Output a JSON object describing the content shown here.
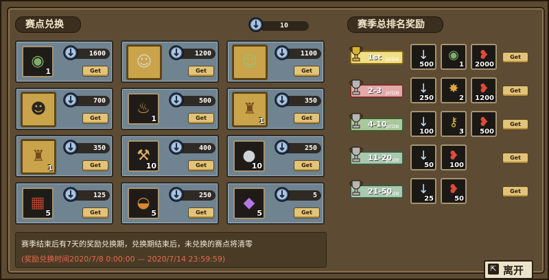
{
  "left_title": "赛点兑换",
  "right_title": "赛季总排名奖励",
  "balance": "10",
  "exchange_items": [
    {
      "icon": "jade-medallion",
      "glyph": "◉",
      "color": "#7fae6b",
      "qty": "1",
      "price": "1600",
      "get": "Get",
      "frame": "plain"
    },
    {
      "icon": "elder-portrait",
      "glyph": "☺",
      "color": "#d9d4c6",
      "qty": "",
      "price": "1200",
      "get": "Get",
      "frame": "gold"
    },
    {
      "icon": "green-warrior-portrait",
      "glyph": "☺",
      "color": "#9bc07a",
      "qty": "",
      "price": "1100",
      "get": "Get",
      "frame": "gold"
    },
    {
      "icon": "girl-portrait",
      "glyph": "☻",
      "color": "#2a2422",
      "qty": "",
      "price": "700",
      "get": "Get",
      "frame": "gold"
    },
    {
      "icon": "money-bag",
      "glyph": "♨",
      "color": "#d89a3a",
      "qty": "1",
      "price": "500",
      "get": "Get",
      "frame": "plain"
    },
    {
      "icon": "treasure-bag",
      "glyph": "♜",
      "color": "#7a4a1e",
      "qty": "1",
      "price": "350",
      "get": "Get",
      "frame": "gold"
    },
    {
      "icon": "treasure-bag",
      "glyph": "♜",
      "color": "#7a4a1e",
      "qty": "1",
      "price": "350",
      "get": "Get",
      "frame": "gold"
    },
    {
      "icon": "wrench-bag",
      "glyph": "⚒",
      "color": "#e0b06a",
      "qty": "10",
      "price": "400",
      "get": "Get",
      "frame": "plain"
    },
    {
      "icon": "bomb",
      "glyph": "●",
      "color": "#cfd3d6",
      "qty": "10",
      "price": "250",
      "get": "Get",
      "frame": "plain"
    },
    {
      "icon": "chocolate-bar",
      "glyph": "▦",
      "color": "#b4452e",
      "qty": "5",
      "price": "125",
      "get": "Get",
      "frame": "plain"
    },
    {
      "icon": "burger",
      "glyph": "◒",
      "color": "#d58a2e",
      "qty": "5",
      "price": "250",
      "get": "Get",
      "frame": "plain"
    },
    {
      "icon": "purple-gem",
      "glyph": "◆",
      "color": "#b678e8",
      "qty": "5",
      "price": "5",
      "get": "Get",
      "frame": "plain"
    }
  ],
  "notice": {
    "line1": "赛季结束后有7天的奖励兑换期，兑换期结束后，未兑换的赛点将清零",
    "line2": "(奖励兑换时间2020/7/8  0:00:00  —  2020/7/14  23:59:59)"
  },
  "ranks": [
    {
      "label": "1st",
      "prize": "prize",
      "bg": "#f0e08a",
      "border": "#8e6a12",
      "trophy": "#d7b231",
      "rewards": [
        {
          "icon": "point-coin",
          "glyph": "↓",
          "color": "#cfe0f0",
          "qty": "500"
        },
        {
          "icon": "jade-medallion",
          "glyph": "◉",
          "color": "#7fae6b",
          "qty": "1"
        },
        {
          "icon": "red-fish",
          "glyph": "❥",
          "color": "#e04a3a",
          "qty": "2000"
        }
      ]
    },
    {
      "label": "2-3",
      "prize": "prize",
      "bg": "#e3a9a9",
      "border": "#7a2f2f",
      "trophy": "#b6b6b6",
      "rewards": [
        {
          "icon": "point-coin",
          "glyph": "↓",
          "color": "#cfe0f0",
          "qty": "250"
        },
        {
          "icon": "gold-badge",
          "glyph": "✸",
          "color": "#e0a83a",
          "qty": "2"
        },
        {
          "icon": "red-fish",
          "glyph": "❥",
          "color": "#e04a3a",
          "qty": "1200"
        }
      ]
    },
    {
      "label": "4-10",
      "prize": "prize",
      "bg": "#a9c89c",
      "border": "#3d5a30",
      "trophy": "#b6b6b6",
      "rewards": [
        {
          "icon": "point-coin",
          "glyph": "↓",
          "color": "#cfe0f0",
          "qty": "100"
        },
        {
          "icon": "golden-key",
          "glyph": "⚷",
          "color": "#e6b43a",
          "qty": "3"
        },
        {
          "icon": "red-fish",
          "glyph": "❥",
          "color": "#e04a3a",
          "qty": "500"
        }
      ]
    },
    {
      "label": "11-20",
      "prize": "prize",
      "bg": "#a9c8b0",
      "border": "#3d5a40",
      "trophy": "#b6b6b6",
      "rewards": [
        {
          "icon": "point-coin",
          "glyph": "↓",
          "color": "#cfe0f0",
          "qty": "50"
        },
        {
          "icon": "red-fish",
          "glyph": "❥",
          "color": "#e04a3a",
          "qty": "100"
        }
      ]
    },
    {
      "label": "21-50",
      "prize": "prize",
      "bg": "#a9c8b0",
      "border": "#3d5a40",
      "trophy": "#b6b6b6",
      "rewards": [
        {
          "icon": "point-coin",
          "glyph": "↓",
          "color": "#cfe0f0",
          "qty": "25"
        },
        {
          "icon": "red-fish",
          "glyph": "❥",
          "color": "#e04a3a",
          "qty": "50"
        }
      ]
    }
  ],
  "rank_get": "Get",
  "leave": {
    "icon": "exit-icon",
    "glyph": "⇱",
    "label": "离开"
  }
}
